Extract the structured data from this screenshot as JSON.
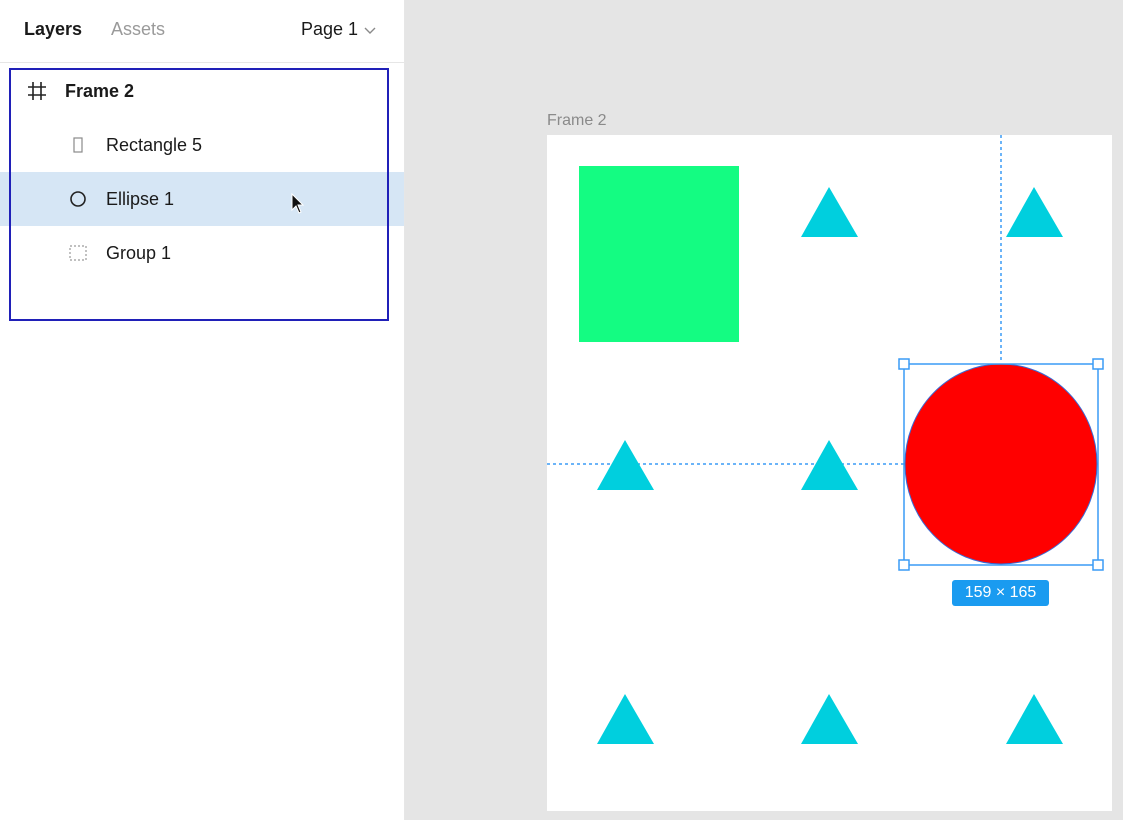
{
  "panel": {
    "tabs": [
      {
        "label": "Layers",
        "active": true
      },
      {
        "label": "Assets",
        "active": false
      }
    ],
    "page_selector": {
      "label": "Page 1"
    }
  },
  "layers": [
    {
      "label": "Frame 2",
      "icon": "frame-hash-icon",
      "selected": false
    },
    {
      "label": "Rectangle 5",
      "icon": "rectangle-icon",
      "selected": false
    },
    {
      "label": "Ellipse 1",
      "icon": "ellipse-icon",
      "selected": true
    },
    {
      "label": "Group 1",
      "icon": "group-dashed-icon",
      "selected": false
    }
  ],
  "canvas": {
    "frame_label": "Frame 2",
    "selection_dimensions": "159 × 165",
    "colors": {
      "rectangle": "#14fc82",
      "ellipse": "#ff0000",
      "triangles": "#00cfde",
      "selection": "#3a9bf5",
      "canvas_bg": "#e5e5e5"
    }
  }
}
